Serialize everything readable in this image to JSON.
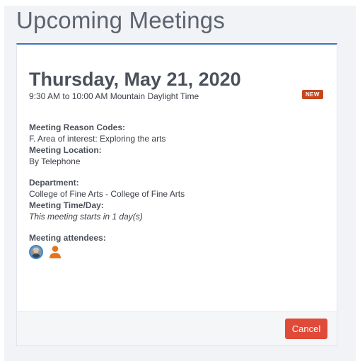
{
  "page": {
    "title": "Upcoming Meetings"
  },
  "meeting": {
    "date": "Thursday, May 21, 2020",
    "time_range": "9:30 AM to 10:00 AM Mountain Daylight Time",
    "badge": "NEW",
    "reason_codes_label": "Meeting Reason Codes:",
    "reason_codes_value": "F. Area of interest: Exploring the arts",
    "location_label": "Meeting Location:",
    "location_value": "By Telephone",
    "department_label": "Department:",
    "department_value": "College of Fine Arts - College of Fine Arts",
    "time_day_label": "Meeting Time/Day:",
    "time_day_value": "This meeting starts in 1 day(s)",
    "attendees_label": "Meeting attendees:",
    "attendees": [
      {
        "type": "photo-avatar",
        "icon": "avatar-photo"
      },
      {
        "type": "generic-person",
        "icon": "person-icon"
      }
    ]
  },
  "footer": {
    "cancel_label": "Cancel"
  },
  "colors": {
    "accent_border": "#3c74c0",
    "badge": "#c9461d",
    "cancel_button": "#e04a38",
    "person_icon": "#e8731b"
  }
}
